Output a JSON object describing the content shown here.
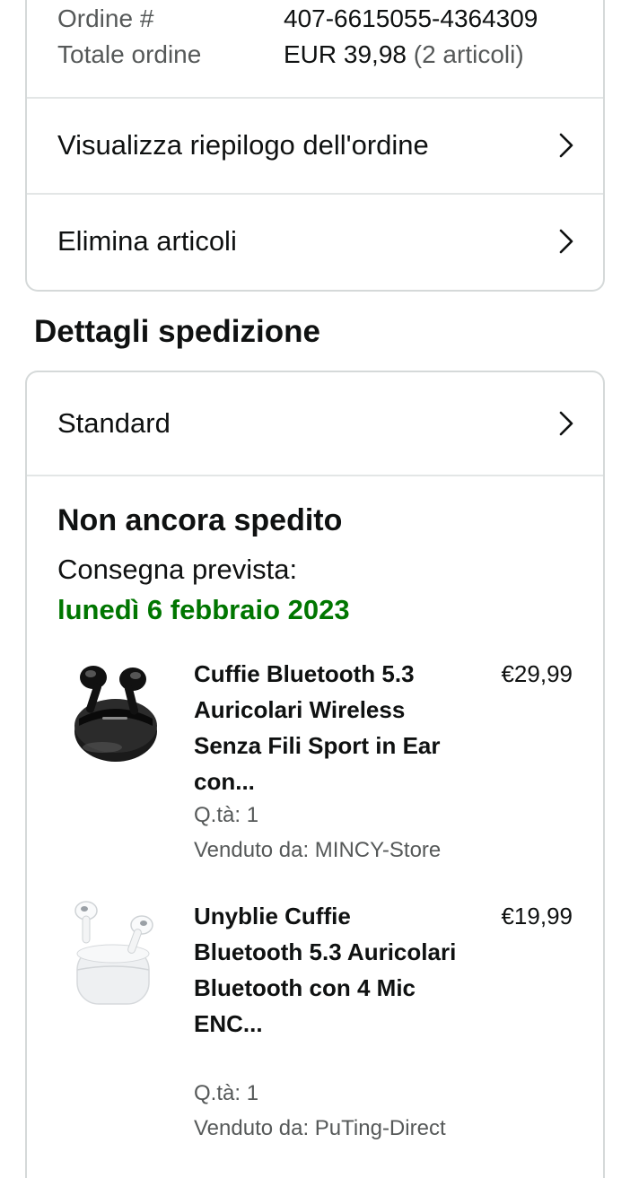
{
  "order": {
    "number_label": "Ordine #",
    "number_value": "407-6615055-4364309",
    "total_label": "Totale ordine",
    "total_value": "EUR 39,98",
    "total_count": "(2 articoli)",
    "links": [
      {
        "label": "Visualizza riepilogo dell'ordine",
        "icon": "chevron-right-icon"
      },
      {
        "label": "Elimina articoli",
        "icon": "chevron-right-icon"
      }
    ]
  },
  "shipping": {
    "section_title": "Dettagli spedizione",
    "method_label": "Standard",
    "status": "Non ancora spedito",
    "delivery_label": "Consegna prevista:",
    "delivery_date": "lunedì 6 febbraio 2023",
    "delivery_color": "#007600",
    "items": [
      {
        "title": "Cuffie Bluetooth 5.3 Auricolari Wireless Senza Fili Sport in Ear con...",
        "price": "€29,99",
        "quantity": "Q.tà: 1",
        "seller": "Venduto da: MINCY-Store",
        "image": "black-earbuds-image"
      },
      {
        "title": "Unyblie Cuffie Bluetooth 5.3 Auricolari Bluetooth con 4 Mic ENC...",
        "price": "€19,99",
        "quantity": "Q.tà: 1",
        "seller": "Venduto da: PuTing-Direct",
        "image": "white-earbuds-image"
      }
    ]
  },
  "colors": {
    "border": "#d5d9d9",
    "divider": "#e3e6e6",
    "text": "#0f1111",
    "muted": "#565959"
  }
}
